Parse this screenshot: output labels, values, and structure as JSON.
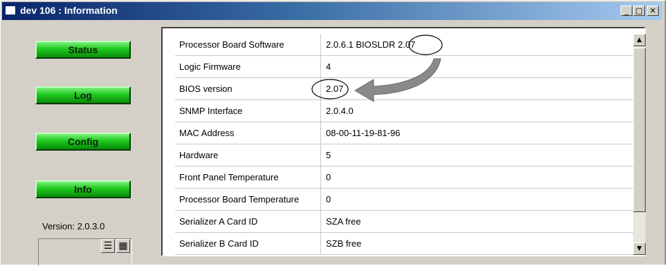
{
  "window": {
    "title": "dev 106 : Information",
    "controls": {
      "minimize": "_",
      "maximize": "□",
      "close": "✕"
    }
  },
  "sidebar": {
    "buttons": [
      {
        "label": "Status"
      },
      {
        "label": "Log"
      },
      {
        "label": "Config"
      },
      {
        "label": "Info"
      }
    ],
    "version_text": "Version: 2.0.3.0",
    "view_icons": [
      "list-view-icon",
      "grid-view-icon"
    ]
  },
  "table": {
    "rows": [
      {
        "label": "Processor Board Software",
        "value": "2.0.6.1 BIOSLDR 2.07"
      },
      {
        "label": "Logic Firmware",
        "value": "4"
      },
      {
        "label": "BIOS version",
        "value": "2.07"
      },
      {
        "label": "SNMP Interface",
        "value": "2.0.4.0"
      },
      {
        "label": "MAC Address",
        "value": "08-00-11-19-81-96"
      },
      {
        "label": "Hardware",
        "value": "5"
      },
      {
        "label": "Front Panel Temperature",
        "value": "0"
      },
      {
        "label": "Processor Board Temperature",
        "value": "0"
      },
      {
        "label": "Serializer A Card ID",
        "value": "SZA free"
      },
      {
        "label": "Serializer B Card ID",
        "value": "SZB free"
      }
    ]
  },
  "scrollbar": {
    "up": "▲",
    "down": "▼"
  },
  "colors": {
    "title_bar": "#0a246a",
    "button_green": "#1ec81e",
    "annotation_gray": "#8a8a8a"
  }
}
